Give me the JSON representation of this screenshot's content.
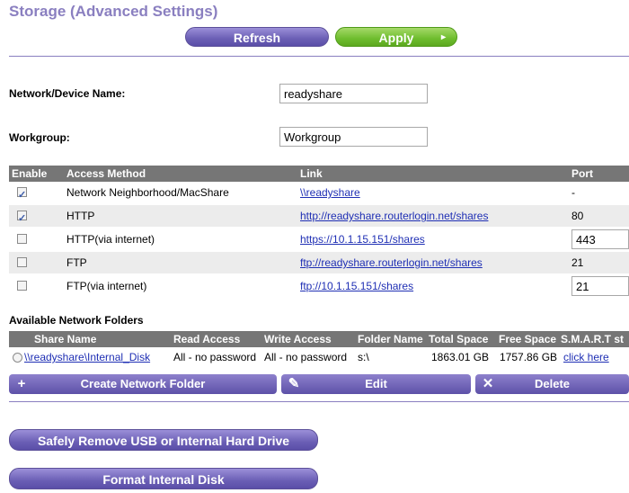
{
  "page_title": "Storage (Advanced Settings)",
  "buttons": {
    "refresh": "Refresh",
    "apply": "Apply",
    "apply_arrow": "▸"
  },
  "network_device_name": {
    "label": "Network/Device Name:",
    "value": "readyshare"
  },
  "workgroup": {
    "label": "Workgroup:",
    "value": "Workgroup"
  },
  "access_table": {
    "headers": [
      "Enable",
      "Access Method",
      "Link",
      "Port"
    ],
    "rows": [
      {
        "enabled": true,
        "method": "Network Neighborhood/MacShare",
        "link": "\\\\readyshare",
        "port": "-",
        "port_editable": false
      },
      {
        "enabled": true,
        "method": "HTTP",
        "link": "http://readyshare.routerlogin.net/shares",
        "port": "80",
        "port_editable": false
      },
      {
        "enabled": false,
        "method": "HTTP(via internet)",
        "link": "https://10.1.15.151/shares",
        "port": "443",
        "port_editable": true
      },
      {
        "enabled": false,
        "method": "FTP",
        "link": "ftp://readyshare.routerlogin.net/shares",
        "port": "21",
        "port_editable": false
      },
      {
        "enabled": false,
        "method": "FTP(via internet)",
        "link": "ftp://10.1.15.151/shares",
        "port": "21",
        "port_editable": true
      }
    ]
  },
  "folders": {
    "section_title": "Available Network Folders",
    "headers": [
      "Share Name",
      "Read Access",
      "Write Access",
      "Folder Name",
      "Total Space",
      "Free Space",
      "S.M.A.R.T st"
    ],
    "rows": [
      {
        "share_name": "\\\\readyshare\\Internal_Disk",
        "read_access": "All - no password",
        "write_access": "All - no password",
        "folder_name": "s:\\",
        "total_space": "1863.01 GB",
        "free_space": "1757.86 GB",
        "smart": "click here"
      }
    ]
  },
  "folder_actions": {
    "create": "Create Network Folder",
    "edit": "Edit",
    "delete": "Delete"
  },
  "safely_remove": "Safely Remove USB or Internal Hard Drive",
  "format_disk": "Format Internal Disk",
  "colors": {
    "accent": "#6b5fb5",
    "title": "#8a7fc0",
    "apply_green": "#6ebd2e",
    "header_gray": "#767676"
  }
}
